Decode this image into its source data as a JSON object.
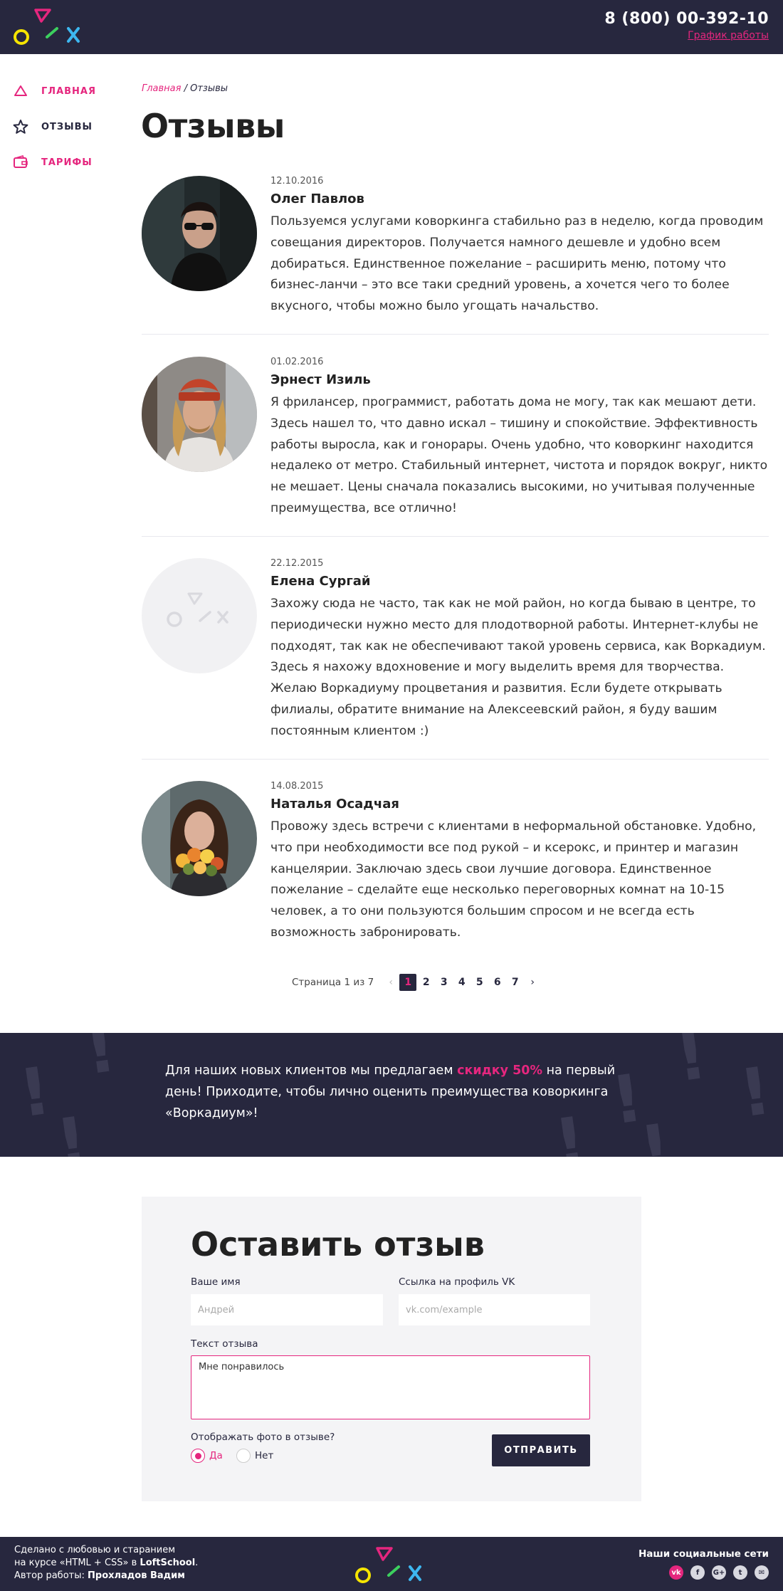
{
  "header": {
    "phone": "8 (800) 00-392-10",
    "schedule_link": "График работы"
  },
  "sidebar": {
    "items": [
      {
        "label": "ГЛАВНАЯ",
        "icon": "triangle-icon"
      },
      {
        "label": "ОТЗЫВЫ",
        "icon": "star-icon"
      },
      {
        "label": "ТАРИФЫ",
        "icon": "wallet-icon"
      }
    ]
  },
  "breadcrumb": {
    "home": "Главная",
    "separator": " / ",
    "current": "Отзывы"
  },
  "page_title": "Отзывы",
  "reviews": [
    {
      "date": "12.10.2016",
      "name": "Олег Павлов",
      "text": "Пользуемся услугами коворкинга стабильно раз в неделю, когда проводим совещания директоров. Получается намного дешевле и удобно всем добираться. Единственное пожелание – расширить меню, потому что бизнес-ланчи – это все таки средний уровень, а хочется чего то более вкусного, чтобы можно было угощать начальство."
    },
    {
      "date": "01.02.2016",
      "name": "Эрнест Изиль",
      "text": "Я фрилансер, программист, работать дома не могу, так как мешают дети. Здесь нашел то, что давно искал – тишину и спокойствие. Эффективность работы выросла, как и гонорары. Очень удобно, что коворкинг находится недалеко от метро. Стабильный интернет, чистота и порядок вокруг, никто не мешает. Цены сначала показались высокими, но учитывая полученные преимущества, все отлично!"
    },
    {
      "date": "22.12.2015",
      "name": "Елена Сургай",
      "text": "Захожу сюда не часто, так как не мой район, но когда бываю в центре, то периодически нужно место для плодотворной работы. Интернет-клубы не подходят, так как не обеспечивают такой уровень сервиса, как Воркадиум. Здесь я нахожу вдохновение и могу выделить время для творчества. Желаю Воркадиуму процветания и развития. Если будете открывать филиалы, обратите внимание на Алексеевский район, я буду вашим постоянным клиентом :)"
    },
    {
      "date": "14.08.2015",
      "name": "Наталья Осадчая",
      "text": "Провожу здесь встречи с клиентами в неформальной обстановке. Удобно, что при необходимости все под рукой – и ксерокс, и принтер и магазин канцелярии. Заключаю здесь свои лучшие договора. Единственное пожелание – сделайте еще несколько переговорных комнат на 10-15 человек, а то они пользуются большим спросом и не всегда есть возможность забронировать."
    }
  ],
  "pagination": {
    "info": "Страница 1 из 7",
    "prev": "‹",
    "next": "›",
    "pages": [
      "1",
      "2",
      "3",
      "4",
      "5",
      "6",
      "7"
    ],
    "current": "1"
  },
  "promo": {
    "before": "Для наших новых клиентов мы предлагаем ",
    "highlight": "скидку 50%",
    "after": " на первый день! Приходите, чтобы лично оценить преимущества коворкинга «Воркадиум»!"
  },
  "form": {
    "title": "Оставить отзыв",
    "name_label": "Ваше имя",
    "name_placeholder": "Андрей",
    "vk_label": "Ссылка на профиль VK",
    "vk_placeholder": "vk.com/example",
    "text_label": "Текст отзыва",
    "text_value": "Мне понравилось",
    "photo_question": "Отображать фото в отзыве?",
    "yes": "Да",
    "no": "Нет",
    "submit": "ОТПРАВИТЬ"
  },
  "footer": {
    "line1": "Сделано с любовью и старанием",
    "line2_prefix": "на курсе «HTML + CSS» в ",
    "line2_school": "LoftSchool",
    "line2_suffix": ".",
    "line3_prefix": "Автор работы: ",
    "line3_author": "Прохладов Вадим",
    "social_title": "Наши социальные сети",
    "socials": [
      {
        "icon": "vk-icon",
        "glyph": "vk"
      },
      {
        "icon": "facebook-icon",
        "glyph": "f"
      },
      {
        "icon": "google-plus-icon",
        "glyph": "G+"
      },
      {
        "icon": "twitter-icon",
        "glyph": "t"
      },
      {
        "icon": "mail-icon",
        "glyph": "✉"
      }
    ]
  },
  "colors": {
    "dark": "#27273e",
    "accent": "#e5267e",
    "logo_yellow": "#f5e400",
    "logo_green": "#3ccf5e",
    "logo_blue": "#3db7f0"
  }
}
